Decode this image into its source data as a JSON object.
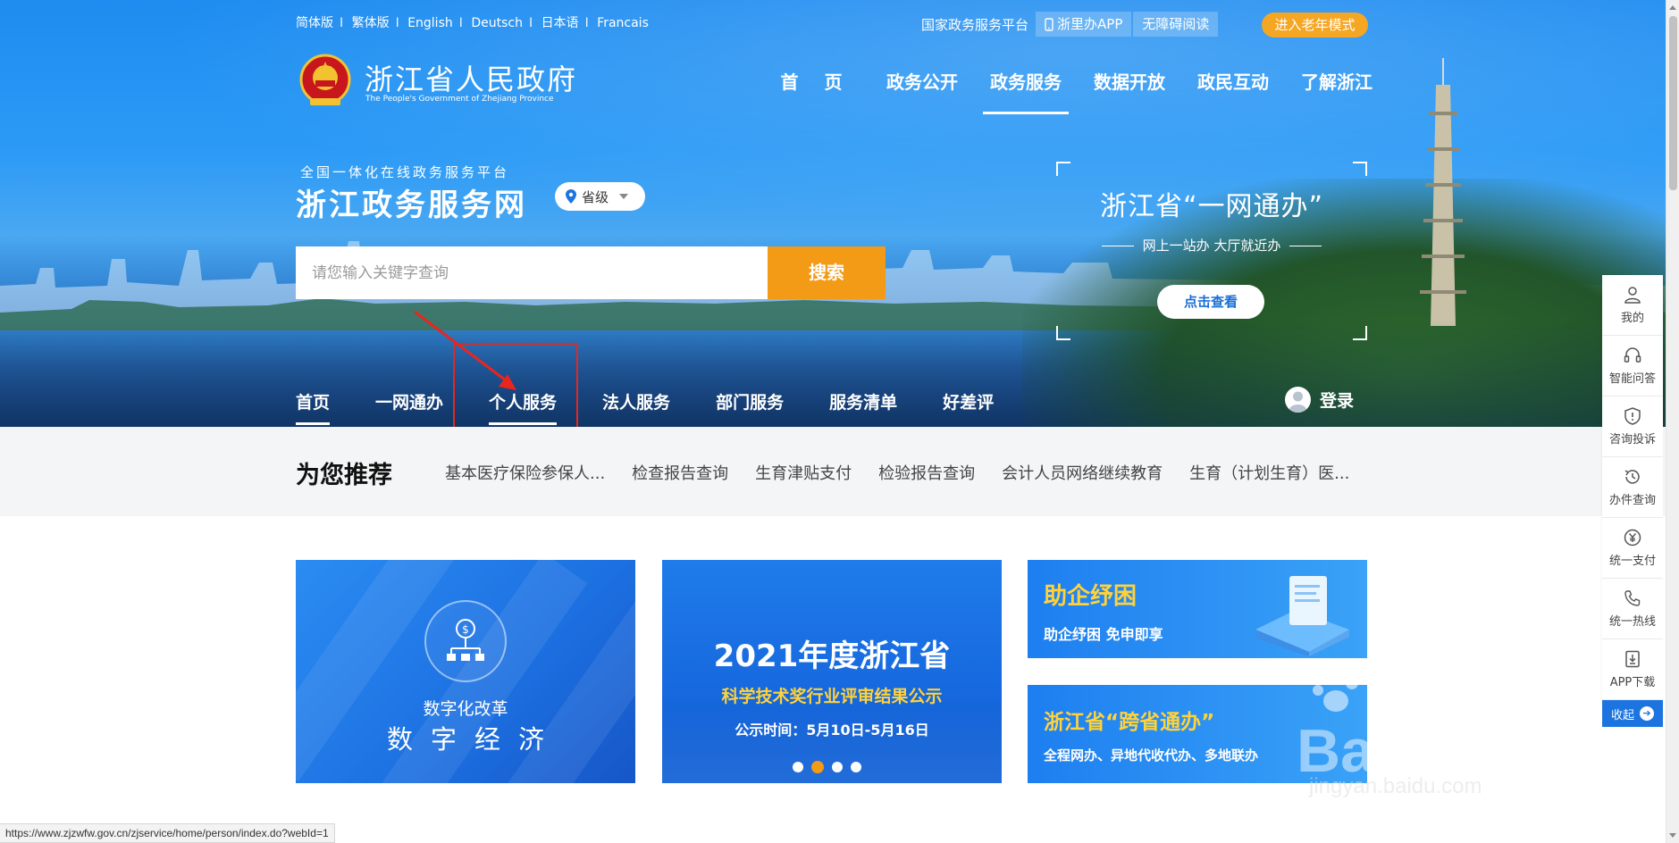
{
  "colors": {
    "accent_orange": "#f39a16",
    "primary_blue": "#1c74e0",
    "highlight_red": "#e8261e",
    "promo_yellow": "#ffd23a"
  },
  "top": {
    "languages": [
      "简体版",
      "繁体版",
      "English",
      "Deutsch",
      "日本语",
      "Francais"
    ],
    "separator": "I",
    "national_platform": "国家政务服务平台",
    "app_link": "浙里办APP",
    "accessible_link": "无障碍阅读",
    "elder_mode": "进入老年模式"
  },
  "brand": {
    "name_cn": "浙江省人民政府",
    "name_en": "The People's Government of Zhejiang Province"
  },
  "main_nav": {
    "items": [
      "首页",
      "政务公开",
      "政务服务",
      "数据开放",
      "政民互动",
      "了解浙江"
    ],
    "active": "政务服务"
  },
  "platform": {
    "subtitle": "全国一体化在线政务服务平台",
    "title": "浙江政务服务网",
    "region": "省级"
  },
  "search": {
    "placeholder": "请您输入关键字查询",
    "button": "搜索"
  },
  "promo": {
    "title": "浙江省“一网通办”",
    "subtitle": "网上一站办 大厅就近办",
    "button": "点击查看"
  },
  "sub_nav": {
    "items": [
      "首页",
      "一网通办",
      "个人服务",
      "法人服务",
      "部门服务",
      "服务清单",
      "好差评"
    ],
    "active": "个人服务",
    "login": "登录"
  },
  "recommend": {
    "title": "为您推荐",
    "links": [
      "基本医疗保险参保人...",
      "检查报告查询",
      "生育津贴支付",
      "检验报告查询",
      "会计人员网络继续教育",
      "生育（计划生育）医..."
    ]
  },
  "cards": {
    "digital": {
      "sub": "数字化改革",
      "main": "数字经济",
      "icon": "money-tree-icon"
    },
    "award": {
      "title": "2021年度浙江省",
      "sub": "科学技术奖行业评审结果公示",
      "time": "公示时间：5月10日-5月16日",
      "slides": 4,
      "active_slide": 2
    },
    "enterprise": {
      "title": "助企纾困",
      "sub": "助企纾困 免申即享"
    },
    "cross": {
      "title": "浙江省“跨省通办”",
      "sub": "全程网办、异地代收代办、多地联办"
    }
  },
  "sidebar": {
    "items": [
      {
        "label": "我的",
        "icon": "user-icon"
      },
      {
        "label": "智能问答",
        "icon": "headset-icon"
      },
      {
        "label": "咨询投诉",
        "icon": "alert-shield-icon"
      },
      {
        "label": "办件查询",
        "icon": "history-icon"
      },
      {
        "label": "统一支付",
        "icon": "yuan-icon"
      },
      {
        "label": "统一热线",
        "icon": "phone-icon"
      },
      {
        "label": "APP下载",
        "icon": "download-icon"
      }
    ],
    "collapse": "收起"
  },
  "status": {
    "url": "https://www.zjzwfw.gov.cn/zjservice/home/person/index.do?webId=1"
  },
  "watermark": {
    "brand": "Bai du 经验",
    "url": "jingyan.baidu.com"
  }
}
